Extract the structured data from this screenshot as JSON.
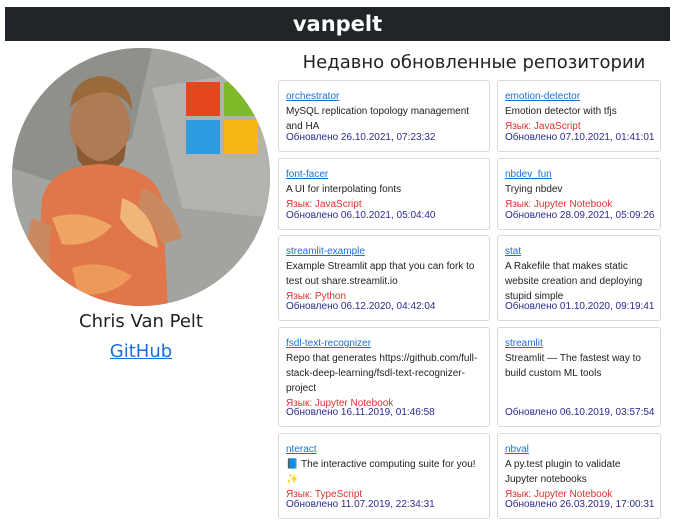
{
  "header": {
    "title": "vanpelt"
  },
  "profile": {
    "name": "Chris Van Pelt",
    "link_label": "GitHub"
  },
  "section": {
    "title": "Недавно обновленные репозитории"
  },
  "repos": [
    {
      "name": "orchestrator",
      "desc": "MySQL replication topology management and HA",
      "lang": "",
      "updated": "Обновлено 26.10.2021, 07:23:32"
    },
    {
      "name": "emotion-detector",
      "desc": "Emotion detector with tfjs",
      "lang": "Язык: JavaScript",
      "updated": "Обновлено 07.10.2021, 01:41:01"
    },
    {
      "name": "font-facer",
      "desc": "A UI for interpolating fonts",
      "lang": "Язык: JavaScript",
      "updated": "Обновлено 06.10.2021, 05:04:40"
    },
    {
      "name": "nbdev_fun",
      "desc": "Trying nbdev",
      "lang": "Язык: Jupyter Notebook",
      "updated": "Обновлено 28.09.2021, 05:09:26"
    },
    {
      "name": "streamlit-example",
      "desc": "Example Streamlit app that you can fork to test out share.streamlit.io",
      "lang": "Язык: Python",
      "updated": "Обновлено 06.12.2020, 04:42:04"
    },
    {
      "name": "stat",
      "desc": "A Rakefile that makes static website creation and deploying stupid simple",
      "lang": "",
      "updated": "Обновлено 01.10.2020, 09:19:41"
    },
    {
      "name": "fsdl-text-recognizer",
      "desc": "Repo that generates https://github.com/full-stack-deep-learning/fsdl-text-recognizer-project",
      "lang": "Язык: Jupyter Notebook",
      "updated": "Обновлено 16.11.2019, 01:46:58"
    },
    {
      "name": "streamlit",
      "desc": "Streamlit — The fastest way to build custom ML tools",
      "lang": "",
      "updated": "Обновлено 06.10.2019, 03:57:54"
    },
    {
      "name": "nteract",
      "desc": "📘 The interactive computing suite for you! ✨",
      "lang": "Язык: TypeScript",
      "updated": "Обновлено 11.07.2019, 22:34:31"
    },
    {
      "name": "nbval",
      "desc": "A py.test plugin to validate Jupyter notebooks",
      "lang": "Язык: Jupyter Notebook",
      "updated": "Обновлено 26.03.2019, 17:00:31"
    }
  ]
}
